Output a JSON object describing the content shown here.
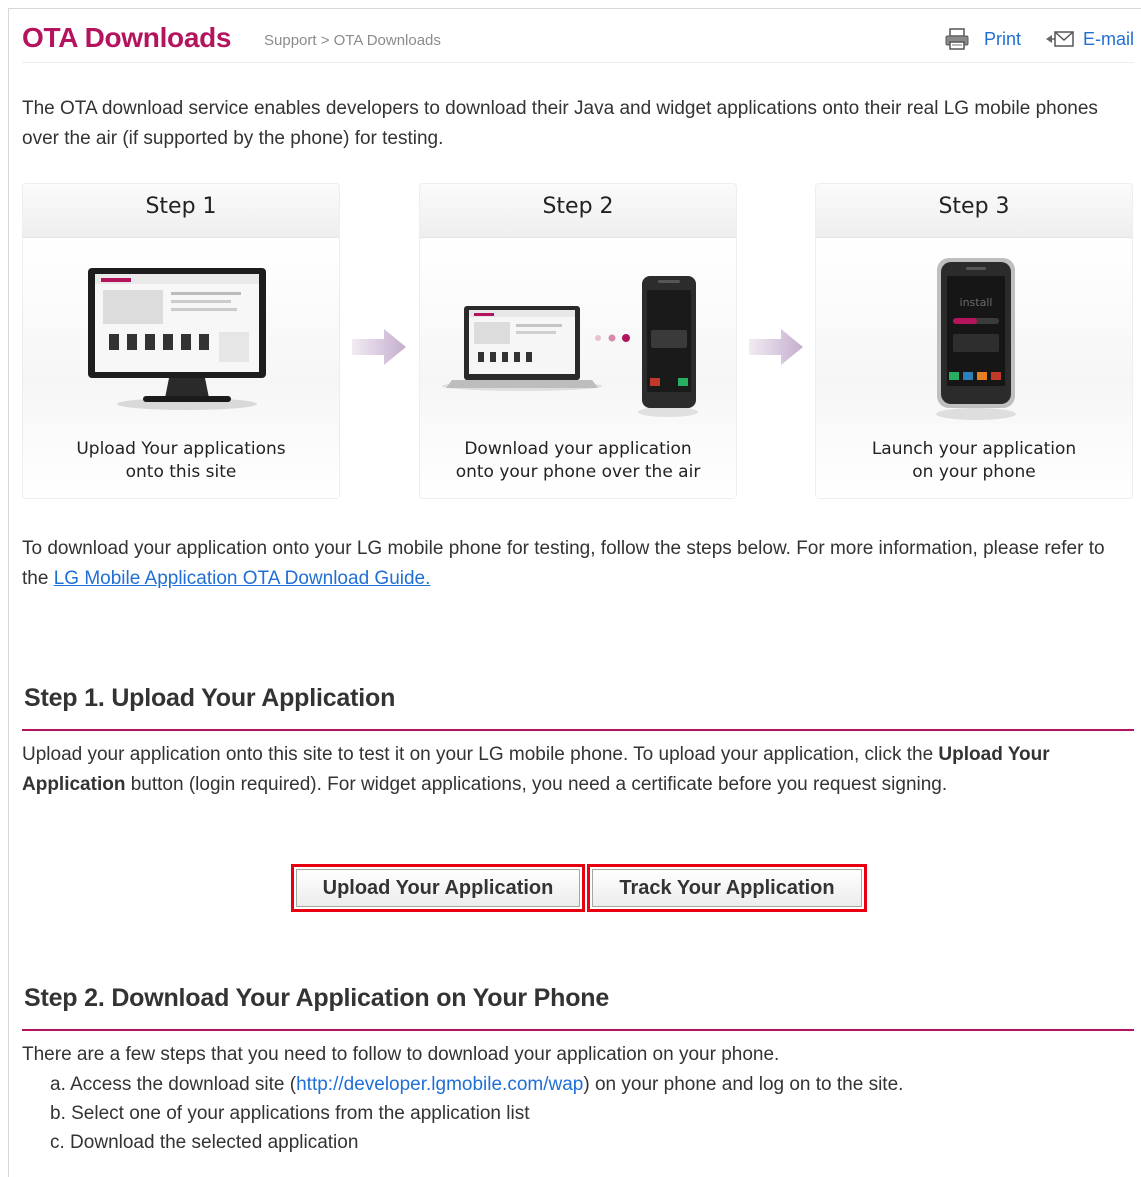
{
  "header": {
    "title": "OTA Downloads",
    "breadcrumb": "Support > OTA Downloads",
    "print_label": "Print",
    "email_label": "E-mail"
  },
  "intro": "The OTA download service enables developers to download their Java and widget applications onto their real LG mobile phones over the air (if supported by the phone) for testing.",
  "steps": [
    {
      "title": "Step 1",
      "caption_line1": "Upload Your applications",
      "caption_line2": "onto this site"
    },
    {
      "title": "Step 2",
      "caption_line1": "Download your application",
      "caption_line2": "onto your phone over the air"
    },
    {
      "title": "Step 3",
      "caption_line1": "Launch your application",
      "caption_line2": "on your phone"
    }
  ],
  "illustration_text": {
    "phone_screen_label": "install"
  },
  "guide_paragraph": {
    "text_before": "To download your application onto your LG mobile phone for testing, follow the steps below. For more information, please refer to the ",
    "link_text": "LG Mobile Application OTA Download Guide."
  },
  "section1": {
    "title": "Step 1. Upload Your Application",
    "text_a": "Upload your application onto this site to test it on your LG mobile phone. To upload your application, click the ",
    "text_bold": "Upload Your Application",
    "text_b": " button (login required). For widget applications, you need a certificate before you request signing.",
    "upload_button": "Upload Your Application",
    "track_button": "Track Your Application"
  },
  "section2": {
    "title": "Step 2. Download Your Application on Your Phone",
    "text": "There are a few steps that you need to follow to download your application on your phone.",
    "item_a_before": "a. Access the download site (",
    "item_a_link": "http://developer.lgmobile.com/wap",
    "item_a_after": ") on your phone and log on to the site.",
    "item_b": "b. Select one of your applications from the application list",
    "item_c": "c. Download the selected application"
  },
  "colors": {
    "accent": "#b4145e",
    "link": "#1f6fd6",
    "highlight_border": "#e60012"
  },
  "icons": [
    "printer-icon",
    "email-icon",
    "arrow-right-icon"
  ]
}
